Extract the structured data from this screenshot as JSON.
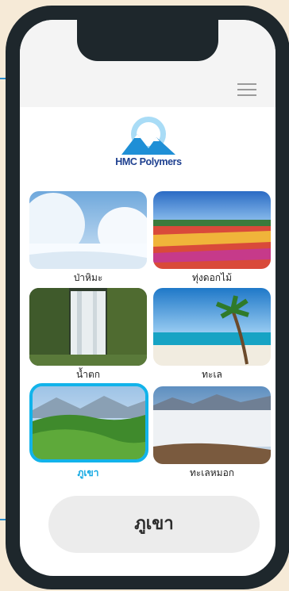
{
  "app": {
    "logo_text": "HMC Polymers"
  },
  "tiles": [
    {
      "label": "ป่าหิมะ",
      "icon": "snow-forest-image"
    },
    {
      "label": "ทุ่งดอกไม้",
      "icon": "flower-field-image"
    },
    {
      "label": "น้ำตก",
      "icon": "waterfall-image"
    },
    {
      "label": "ทะเล",
      "icon": "beach-image"
    },
    {
      "label": "ภูเขา",
      "icon": "mountain-image",
      "selected": true
    },
    {
      "label": "ทะเลหมอก",
      "icon": "sea-of-mist-image"
    }
  ],
  "selection": {
    "current": "ภูเขา"
  },
  "colors": {
    "accent": "#12b3ea",
    "frame": "#1e272c",
    "background": "#f6ead7",
    "brand": "#1d3f8f"
  }
}
